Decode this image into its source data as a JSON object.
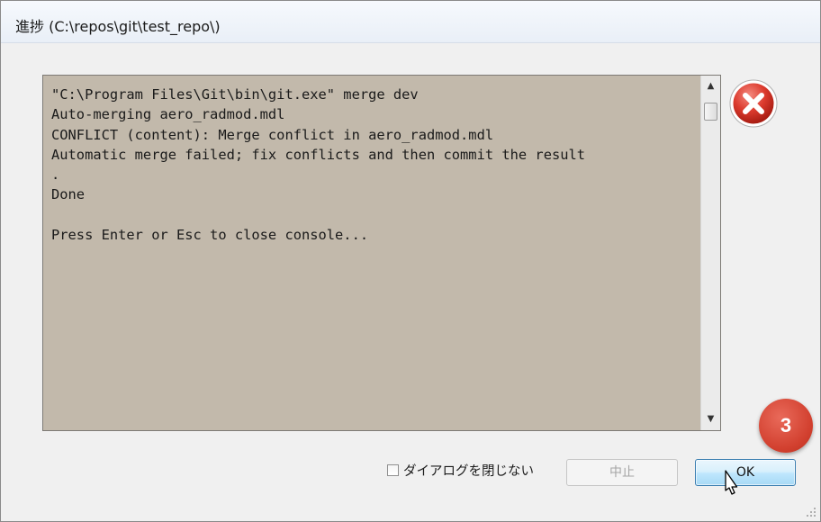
{
  "window": {
    "title": "進捗 (C:\\repos\\git\\test_repo\\)"
  },
  "console": {
    "lines": "\"C:\\Program Files\\Git\\bin\\git.exe\" merge dev\nAuto-merging aero_radmod.mdl\nCONFLICT (content): Merge conflict in aero_radmod.mdl\nAutomatic merge failed; fix conflicts and then commit the result\n.\nDone\n\nPress Enter or Esc to close console..."
  },
  "status": {
    "icon": "error-icon",
    "color": "#d9362b"
  },
  "annotation": {
    "step": "3"
  },
  "footer": {
    "keep_open_label": "ダイアログを閉じない",
    "abort_label": "中止",
    "ok_label": "OK"
  }
}
